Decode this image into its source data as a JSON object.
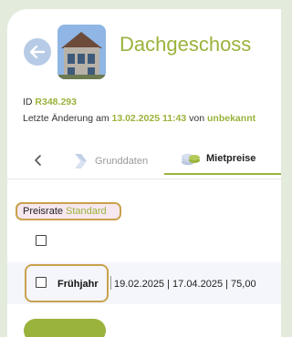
{
  "header": {
    "title": "Dachgeschoss",
    "id_label": "ID",
    "id_value": "R348.293",
    "changed_prefix": "Letzte Änderung am",
    "changed_datetime": "13.02.2025 11:43",
    "changed_by_label": "von",
    "changed_by": "unbekannt"
  },
  "tabs": [
    {
      "label": "Grunddaten",
      "active": false
    },
    {
      "label": "Mietpreise",
      "active": true
    }
  ],
  "rate": {
    "label": "Preisrate",
    "value": "Standard"
  },
  "rows": [
    {
      "name": "Frühjahr",
      "details": "19.02.2025 | 17.04.2025 | 75,00"
    }
  ],
  "colors": {
    "accent": "#9ab33c",
    "highlight": "#c9a14d"
  }
}
